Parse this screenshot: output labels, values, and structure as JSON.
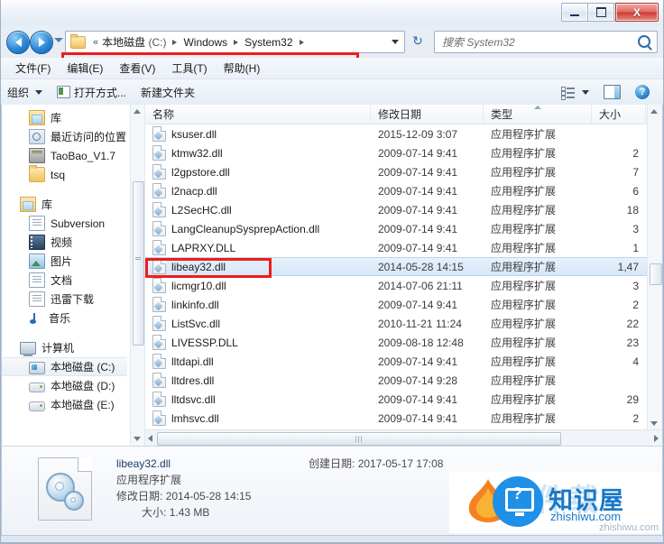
{
  "window": {
    "minimize_label": "最小化",
    "maximize_label": "最大化",
    "close_label": "X"
  },
  "address": {
    "back_label": "后退",
    "forward_label": "前进",
    "double_chevron": "«",
    "crumbs": [
      {
        "label": "本地磁盘",
        "sub": " (C:)"
      },
      {
        "label": "Windows",
        "sub": ""
      },
      {
        "label": "System32",
        "sub": ""
      }
    ],
    "refresh_icon": "↻"
  },
  "search": {
    "placeholder": "搜索 System32"
  },
  "menubar": {
    "items": [
      {
        "label": "文件(F)"
      },
      {
        "label": "编辑(E)"
      },
      {
        "label": "查看(V)"
      },
      {
        "label": "工具(T)"
      },
      {
        "label": "帮助(H)"
      }
    ]
  },
  "commandbar": {
    "organize": "组织",
    "open_with": "打开方式...",
    "new_folder": "新建文件夹",
    "help_glyph": "?"
  },
  "navpane": {
    "favorites": [
      {
        "label": "库",
        "icon": "library-icon"
      },
      {
        "label": "最近访问的位置",
        "icon": "recent-places-icon"
      },
      {
        "label": "TaoBao_V1.7",
        "icon": "archive-icon"
      },
      {
        "label": "tsq",
        "icon": "folder-icon"
      }
    ],
    "libraries_header": {
      "label": "库",
      "icon": "library-icon"
    },
    "libraries": [
      {
        "label": "Subversion",
        "icon": "document-icon"
      },
      {
        "label": "视频",
        "icon": "video-icon"
      },
      {
        "label": "图片",
        "icon": "picture-icon"
      },
      {
        "label": "文档",
        "icon": "document-icon"
      },
      {
        "label": "迅雷下载",
        "icon": "download-icon"
      },
      {
        "label": "音乐",
        "icon": "music-icon"
      }
    ],
    "computer_header": {
      "label": "计算机",
      "icon": "computer-icon"
    },
    "drives": [
      {
        "label": "本地磁盘 (C:)",
        "icon": "system-drive-icon",
        "selected": true
      },
      {
        "label": "本地磁盘 (D:)",
        "icon": "drive-icon",
        "selected": false
      },
      {
        "label": "本地磁盘 (E:)",
        "icon": "drive-icon",
        "selected": false
      }
    ]
  },
  "filelist": {
    "columns": [
      {
        "key": "name",
        "label": "名称",
        "sorted": false
      },
      {
        "key": "date",
        "label": "修改日期",
        "sorted": false
      },
      {
        "key": "type",
        "label": "类型",
        "sorted": true
      },
      {
        "key": "size",
        "label": "大小",
        "sorted": false
      }
    ],
    "rows": [
      {
        "name": "ksuser.dll",
        "date": "2015-12-09 3:07",
        "type": "应用程序扩展",
        "size": "",
        "selected": false
      },
      {
        "name": "ktmw32.dll",
        "date": "2009-07-14 9:41",
        "type": "应用程序扩展",
        "size": "2",
        "selected": false
      },
      {
        "name": "l2gpstore.dll",
        "date": "2009-07-14 9:41",
        "type": "应用程序扩展",
        "size": "7",
        "selected": false
      },
      {
        "name": "l2nacp.dll",
        "date": "2009-07-14 9:41",
        "type": "应用程序扩展",
        "size": "6",
        "selected": false
      },
      {
        "name": "L2SecHC.dll",
        "date": "2009-07-14 9:41",
        "type": "应用程序扩展",
        "size": "18",
        "selected": false
      },
      {
        "name": "LangCleanupSysprepAction.dll",
        "date": "2009-07-14 9:41",
        "type": "应用程序扩展",
        "size": "3",
        "selected": false
      },
      {
        "name": "LAPRXY.DLL",
        "date": "2009-07-14 9:41",
        "type": "应用程序扩展",
        "size": "1",
        "selected": false
      },
      {
        "name": "libeay32.dll",
        "date": "2014-05-28 14:15",
        "type": "应用程序扩展",
        "size": "1,47",
        "selected": true
      },
      {
        "name": "licmgr10.dll",
        "date": "2014-07-06 21:11",
        "type": "应用程序扩展",
        "size": "3",
        "selected": false
      },
      {
        "name": "linkinfo.dll",
        "date": "2009-07-14 9:41",
        "type": "应用程序扩展",
        "size": "2",
        "selected": false
      },
      {
        "name": "ListSvc.dll",
        "date": "2010-11-21 11:24",
        "type": "应用程序扩展",
        "size": "22",
        "selected": false
      },
      {
        "name": "LIVESSP.DLL",
        "date": "2009-08-18 12:48",
        "type": "应用程序扩展",
        "size": "23",
        "selected": false
      },
      {
        "name": "lltdapi.dll",
        "date": "2009-07-14 9:41",
        "type": "应用程序扩展",
        "size": "4",
        "selected": false
      },
      {
        "name": "lltdres.dll",
        "date": "2009-07-14 9:28",
        "type": "应用程序扩展",
        "size": "",
        "selected": false
      },
      {
        "name": "lltdsvc.dll",
        "date": "2009-07-14 9:41",
        "type": "应用程序扩展",
        "size": "29",
        "selected": false
      },
      {
        "name": "lmhsvc.dll",
        "date": "2009-07-14 9:41",
        "type": "应用程序扩展",
        "size": "2",
        "selected": false
      }
    ]
  },
  "details": {
    "filename": "libeay32.dll",
    "filetype": "应用程序扩展",
    "modified_label": "修改日期:",
    "modified_value": "2014-05-28 14:15",
    "size_label": "大小:",
    "size_value": "1.43 MB",
    "created_label": "创建日期:",
    "created_value": "2017-05-17 17:08"
  },
  "watermark": {
    "name": "知识屋",
    "url": "zhishiwu.com",
    "url_small": "zhishiwu.com",
    "ghost_text": "软件载"
  },
  "colors": {
    "accent": "#1e90e8",
    "selection": "#d6e7f8",
    "highlight_box": "#ef1c1c",
    "close_button": "#cc3a31"
  }
}
